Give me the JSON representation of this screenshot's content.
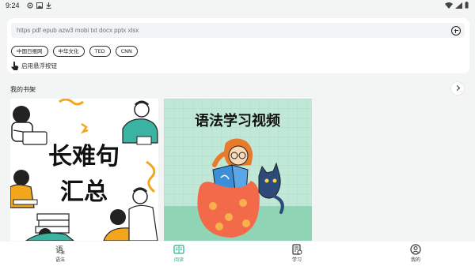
{
  "status": {
    "time": "9:24"
  },
  "search": {
    "placeholder": "https pdf epub azw3 mobi txt docx pptx xlsx"
  },
  "chips": [
    "中国日报网",
    "中华文化",
    "TED",
    "CNN"
  ],
  "float_toggle": {
    "label": "启用悬浮按钮"
  },
  "shelf": {
    "title": "我的书架",
    "books": [
      {
        "title_line1": "长难句",
        "title_line2": "汇总"
      },
      {
        "title": "语法学习视频"
      }
    ]
  },
  "nav": {
    "items": [
      {
        "label": "语法",
        "icon": "grammar-icon"
      },
      {
        "label": "阅读",
        "icon": "book-open-icon"
      },
      {
        "label": "学习",
        "icon": "study-clipboard-icon"
      },
      {
        "label": "我的",
        "icon": "profile-icon"
      }
    ],
    "active_index": 1
  },
  "colors": {
    "accent": "#2bb58a",
    "book2_bg": "#bfe8d6",
    "book1_accent": "#f3a61c"
  }
}
